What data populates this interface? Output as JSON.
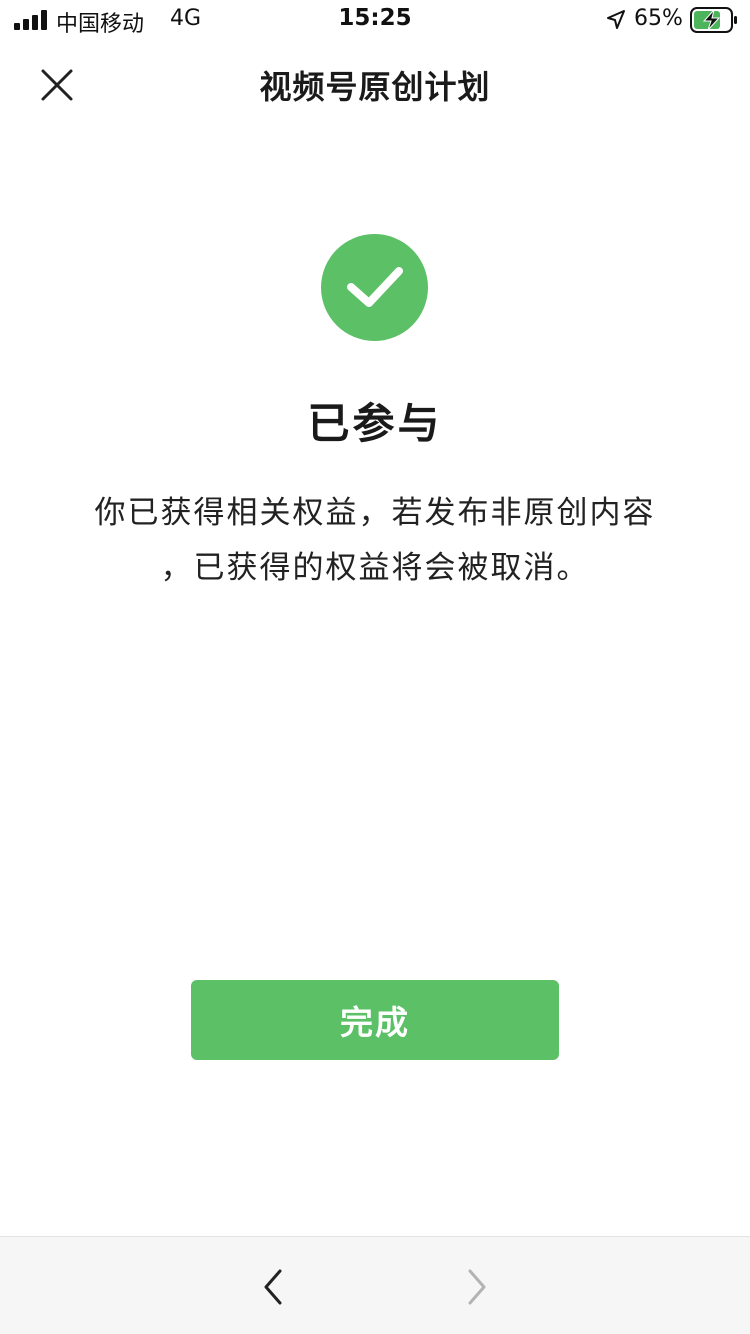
{
  "status_bar": {
    "carrier": "中国移动",
    "network": "4G",
    "time": "15:25",
    "battery_percent": "65%",
    "icons": [
      "signal-icon",
      "location-icon",
      "battery-charging-icon"
    ]
  },
  "nav": {
    "title": "视频号原创计划",
    "close_icon": "close-icon"
  },
  "result": {
    "icon": "check-circle-icon",
    "title": "已参与",
    "description_line1": "你已获得相关权益，若发布非原创内容",
    "description_line2": "，已获得的权益将会被取消。"
  },
  "actions": {
    "done_label": "完成"
  },
  "toolbar": {
    "back_icon": "chevron-left-icon",
    "forward_icon": "chevron-right-icon"
  },
  "colors": {
    "accent": "#5bc066",
    "toolbar_bg": "#f6f6f6",
    "text": "#1a1a1a",
    "forward_disabled": "#b3b3b3"
  }
}
